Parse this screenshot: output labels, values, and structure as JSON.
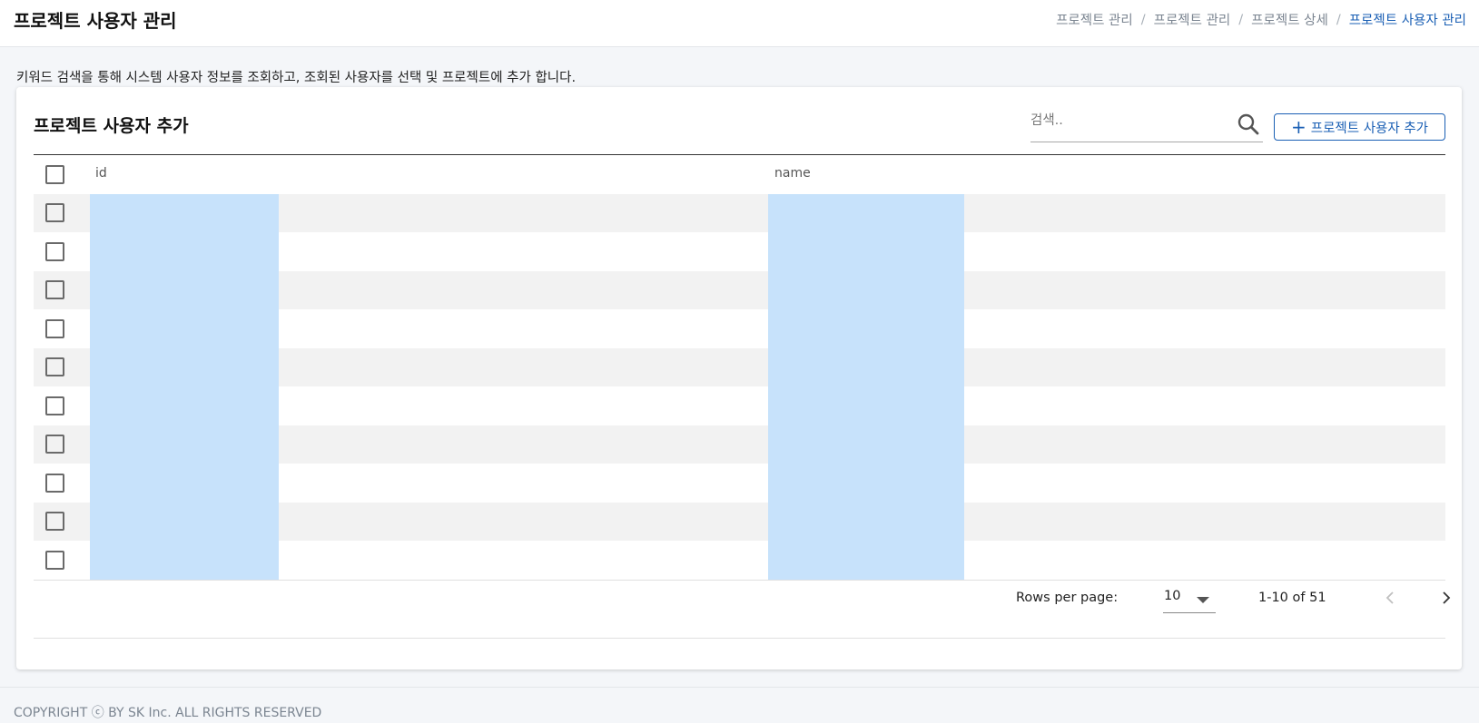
{
  "header": {
    "title": "프로젝트 사용자 관리",
    "breadcrumb": [
      "프로젝트 관리",
      "프로젝트 관리",
      "프로젝트 상세",
      "프로젝트 사용자 관리"
    ],
    "separator": "/"
  },
  "description": "키워드 검색을 통해 시스템 사용자 정보를 조회하고, 조회된 사용자를 선택 및 프로젝트에 추가 합니다.",
  "card": {
    "title": "프로젝트 사용자 추가",
    "search": {
      "placeholder": "검색..",
      "value": "",
      "icon": "search-icon"
    },
    "add_button": {
      "icon": "plus-icon",
      "label": "프로젝트 사용자 추가"
    }
  },
  "table": {
    "columns": [
      "id",
      "name"
    ],
    "rows": [
      {
        "id": "",
        "name": ""
      },
      {
        "id": "",
        "name": ""
      },
      {
        "id": "",
        "name": ""
      },
      {
        "id": "",
        "name": ""
      },
      {
        "id": "",
        "name": ""
      },
      {
        "id": "",
        "name": ""
      },
      {
        "id": "",
        "name": ""
      },
      {
        "id": "",
        "name": ""
      },
      {
        "id": "",
        "name": ""
      },
      {
        "id": "",
        "name": ""
      }
    ],
    "redaction_color": "#c7e2fb"
  },
  "pagination": {
    "rows_per_page_label": "Rows per page:",
    "rows_per_page": "10",
    "range": "1-10 of 51"
  },
  "footer": {
    "copyright": "COPYRIGHT ⓒ BY SK Inc. ALL RIGHTS RESERVED"
  },
  "colors": {
    "accent": "#1a5fb4",
    "muted": "#7b8591",
    "row_stripe": "#f2f2f2"
  }
}
